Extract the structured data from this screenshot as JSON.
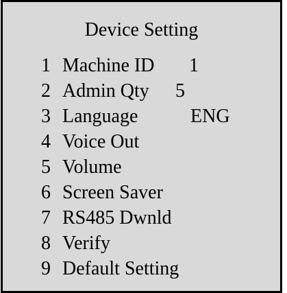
{
  "screen": {
    "title": "Device Setting"
  },
  "menu": {
    "items": [
      {
        "index": "1",
        "label": "Machine ID",
        "value": "1"
      },
      {
        "index": "2",
        "label": "Admin Qty",
        "value": "5"
      },
      {
        "index": "3",
        "label": "Language",
        "value": "ENG"
      },
      {
        "index": "4",
        "label": "Voice Out"
      },
      {
        "index": "5",
        "label": "Volume"
      },
      {
        "index": "6",
        "label": "Screen Saver"
      },
      {
        "index": "7",
        "label": "RS485 Dwnld"
      },
      {
        "index": "8",
        "label": "Verify"
      },
      {
        "index": "9",
        "label": "Default Setting"
      }
    ]
  },
  "colors": {
    "panel_bg": "#d9d9d9",
    "border": "#000000",
    "text": "#000000"
  }
}
